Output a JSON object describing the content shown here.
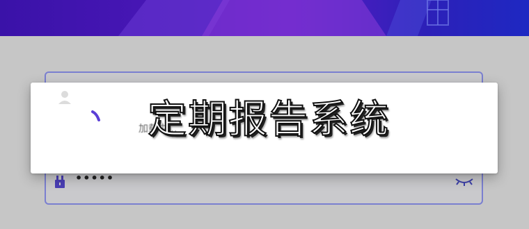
{
  "banner": {
    "name": "header-banner"
  },
  "login": {
    "username": {
      "value": "",
      "placeholder": "",
      "icon": "user-icon"
    },
    "password": {
      "value": "•••••",
      "icon": "lock-icon",
      "toggle_icon": "eye-closed-icon"
    }
  },
  "dialog": {
    "title": "定期报告系统",
    "loading_text": "加载中...",
    "spinner_icon": "loading-spinner-icon"
  },
  "colors": {
    "banner_start": "#3a12a8",
    "banner_end": "#1e28c2",
    "accent": "#5b3fd6",
    "card_border": "#7a7fd0",
    "background": "#c6c6c6"
  }
}
